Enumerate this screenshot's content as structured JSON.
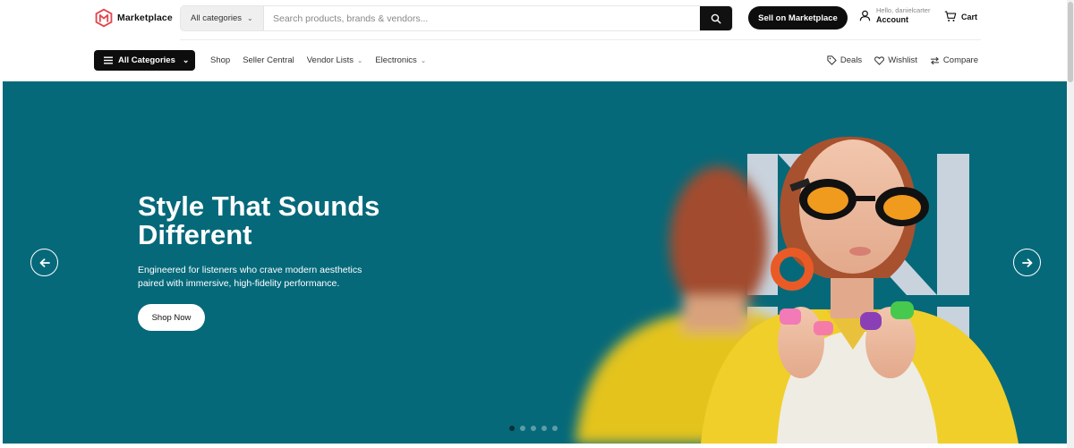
{
  "brand": {
    "name": "Marketplace",
    "accent": "#e0464e"
  },
  "search": {
    "category_label": "All categories",
    "placeholder": "Search products, brands & vendors..."
  },
  "header": {
    "sell_label": "Sell on Marketplace",
    "account_hello": "Hello, danielcarter",
    "account_label": "Account",
    "cart_label": "Cart"
  },
  "nav": {
    "all_categories_label": "All Categories",
    "links": [
      {
        "label": "Shop",
        "dropdown": false
      },
      {
        "label": "Seller Central",
        "dropdown": false
      },
      {
        "label": "Vendor Lists",
        "dropdown": true
      },
      {
        "label": "Electronics",
        "dropdown": true
      }
    ],
    "right": [
      {
        "label": "Deals",
        "icon": "tag-icon"
      },
      {
        "label": "Wishlist",
        "icon": "heart-icon"
      },
      {
        "label": "Compare",
        "icon": "compare-icon"
      }
    ]
  },
  "hero": {
    "title": "Style That Sounds Different",
    "subtitle": "Engineered for listeners who crave modern aesthetics paired with immersive, high-fidelity performance.",
    "cta_label": "Shop Now",
    "background": "#05697a",
    "slides_count": 5,
    "active_slide": 1
  }
}
